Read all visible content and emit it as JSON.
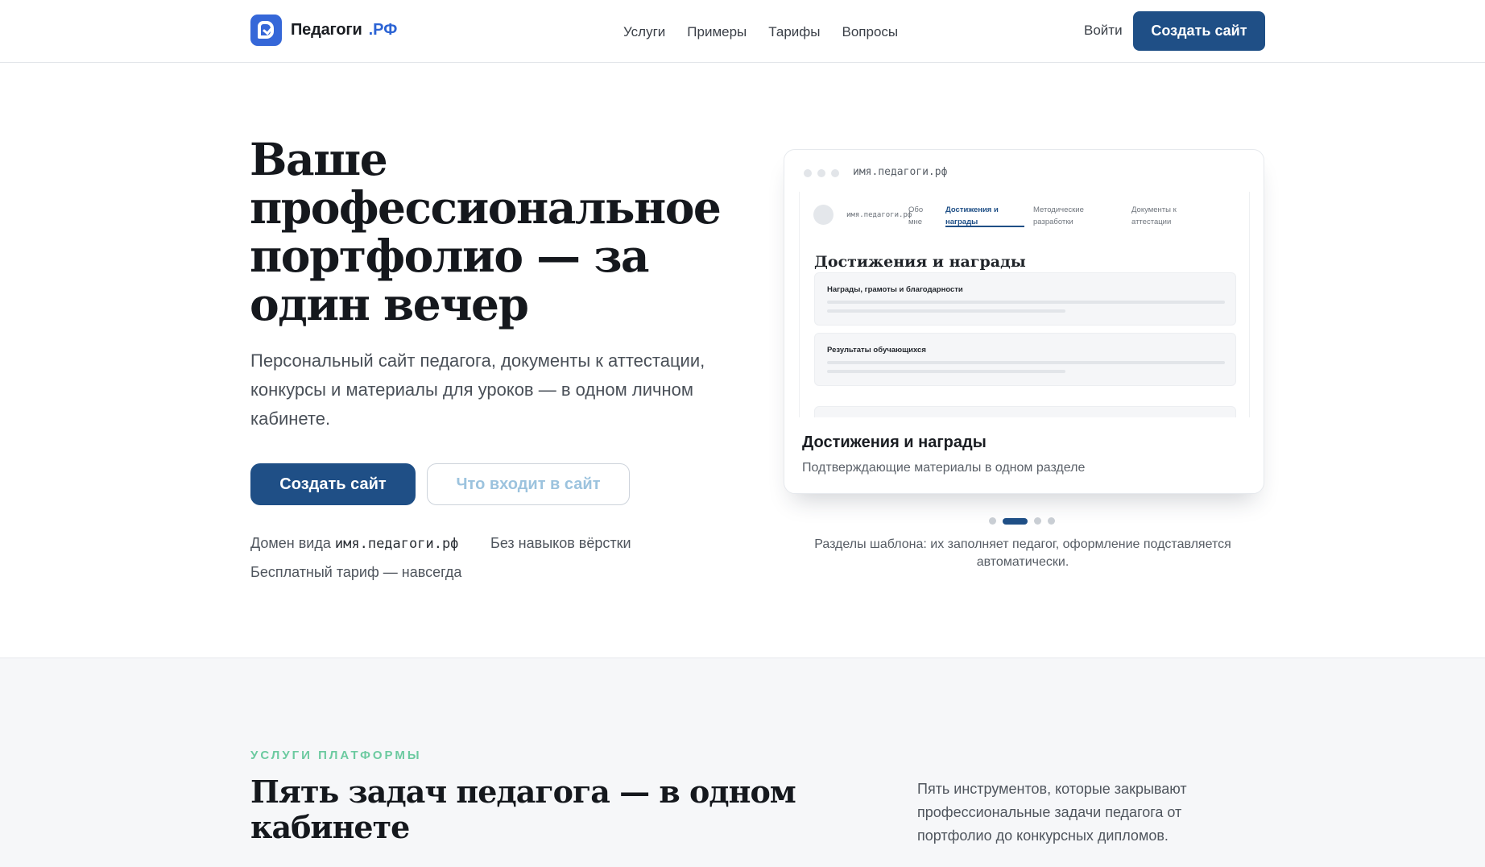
{
  "header": {
    "brand_name": "Педагоги",
    "brand_tld": ".РФ",
    "nav": [
      "Услуги",
      "Примеры",
      "Тарифы",
      "Вопросы"
    ],
    "login_label": "Войти",
    "cta_label": "Создать сайт"
  },
  "hero": {
    "title": "Ваше профессиональное портфолио — за один вечер",
    "subtitle": "Персональный сайт педагога, документы к аттестации, конкурсы и материалы для уроков — в одном личном кабинете.",
    "primary_button": "Создать сайт",
    "secondary_button": "Что входит в сайт",
    "features": {
      "domain_prefix": "Домен вида",
      "domain_example": "имя.педагоги.рф",
      "no_coding": "Без навыков вёрстки",
      "free_plan": "Бесплатный тариф — навсегда"
    }
  },
  "preview": {
    "url": "имя.педагоги.рф",
    "mini_domain": "имя.педагоги.рф",
    "tabs": [
      "Обо мне",
      "Достижения и награды",
      "Методические разработки",
      "Документы к аттестации"
    ],
    "active_tab_index": 1,
    "heading": "Достижения и награды",
    "blocks": [
      "Награды, грамоты и благодарности",
      "Результаты обучающихся"
    ],
    "card_title": "Достижения и награды",
    "card_desc": "Подтверждающие материалы в одном разделе",
    "slides_total": 4,
    "active_slide_index": 1,
    "caption": "Разделы шаблона: их заполняет педагог, оформление подставляется автоматически."
  },
  "services": {
    "eyebrow": "УСЛУГИ ПЛАТФОРМЫ",
    "title": "Пять задач педагога — в одном кабинете",
    "description": "Пять инструментов, которые закрывают профессиональные задачи педагога от портфолио до конкурсных дипломов."
  },
  "colors": {
    "primary": "#1f4f86",
    "logo": "#3567d8",
    "accent_eyebrow": "#6ccaa0"
  }
}
